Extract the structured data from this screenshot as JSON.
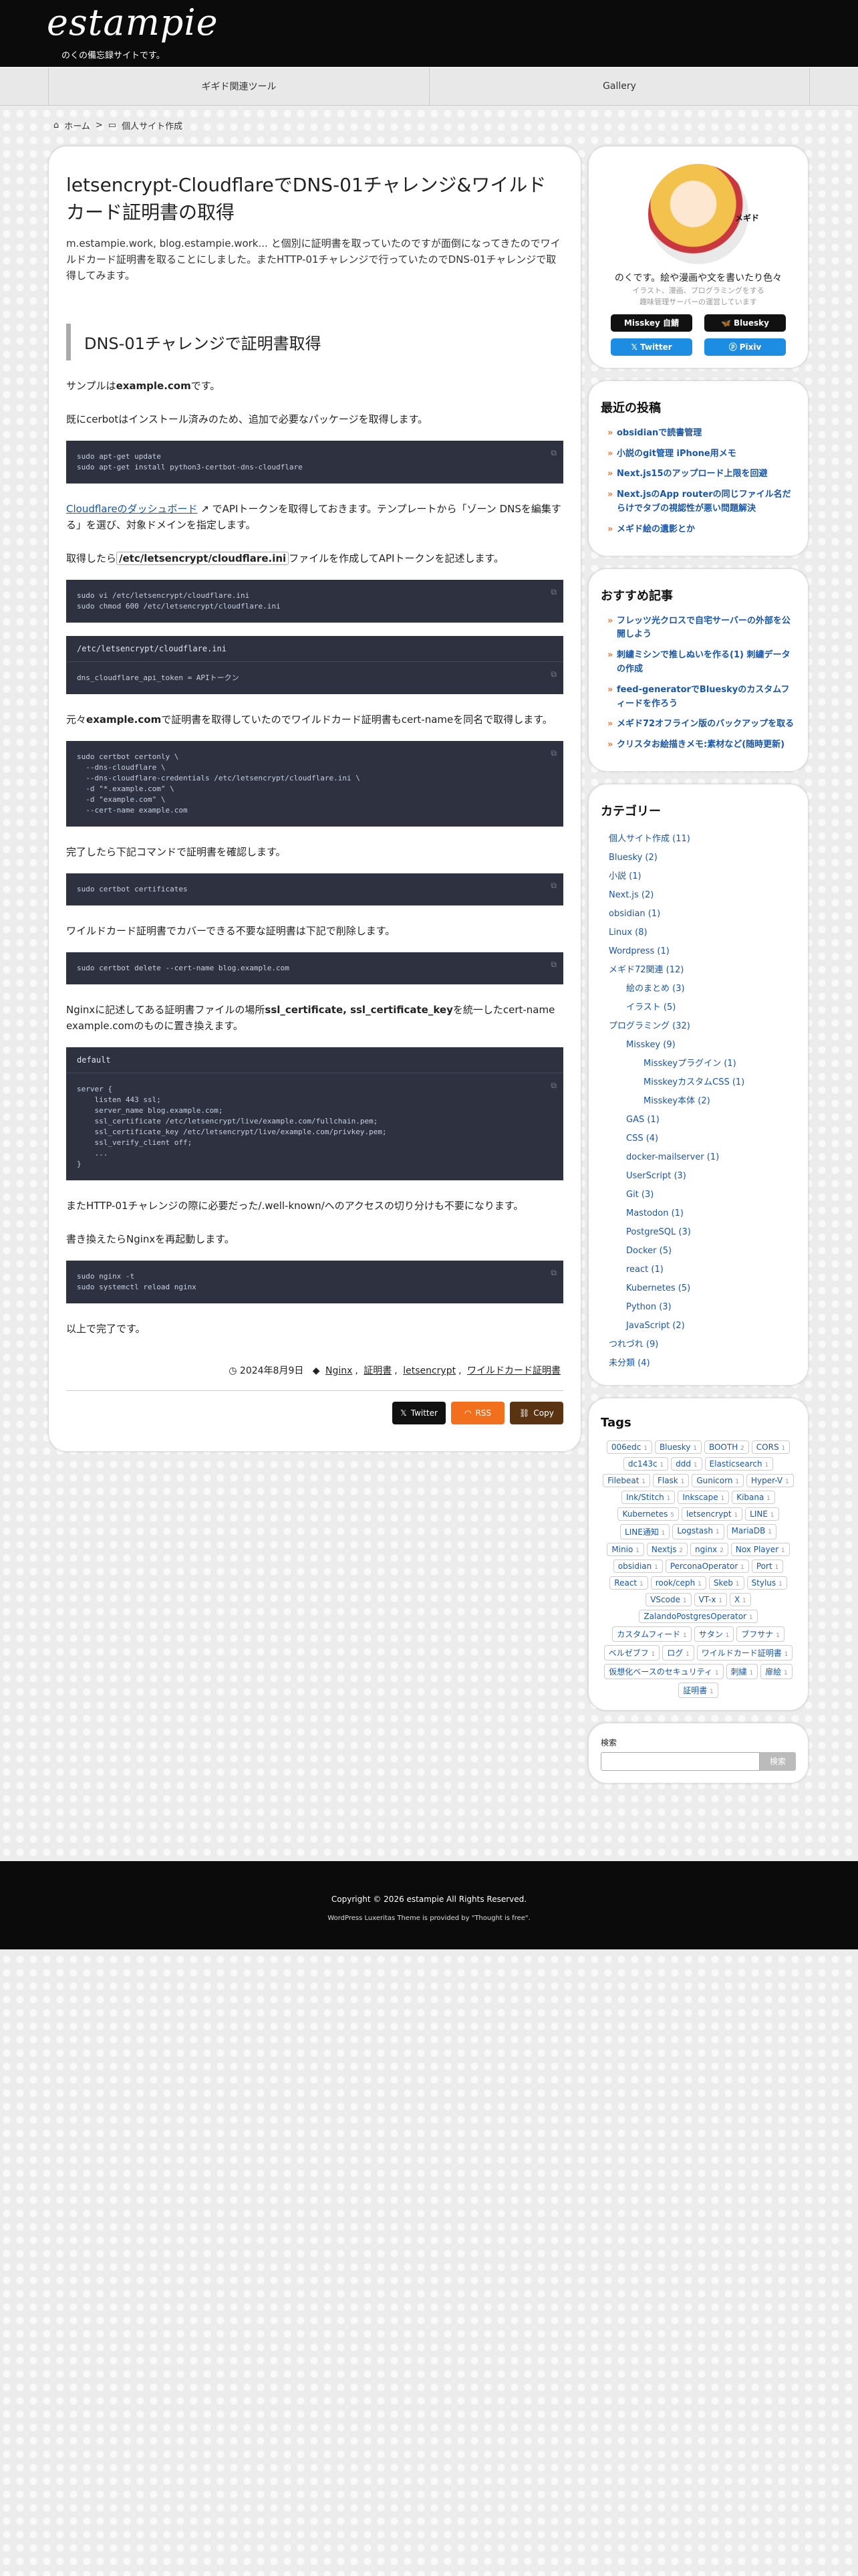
{
  "site": {
    "logo": "estampie",
    "tagline": "のくの備忘録サイトです。"
  },
  "nav": [
    "ギギド関連ツール",
    "Gallery"
  ],
  "breadcrumb": {
    "home": "ホーム",
    "category": "個人サイト作成"
  },
  "article": {
    "title": "letsencrypt-CloudflareでDNS-01チャレンジ&ワイルドカード証明書の取得",
    "lead": "m.estampie.work, blog.estampie.work... と個別に証明書を取っていたのですが面倒になってきたのでワイルドカード証明書を取ることにしました。またHTTP-01チャレンジで行っていたのでDNS-01チャレンジで取得してみます。",
    "h2": "DNS-01チャレンジで証明書取得",
    "p1a": "サンプルは",
    "p1b": "example.com",
    "p1c": "です。",
    "p2": "既にcerbotはインストール済みのため、追加で必要なパッケージを取得します。",
    "code1": "sudo apt-get update\nsudo apt-get install python3-certbot-dns-cloudflare",
    "p3link": "Cloudflareのダッシュボード",
    "p3": "でAPIトークンを取得しておきます。テンプレートから「ゾーン DNSを編集する」を選び、対象ドメインを指定します。",
    "p4a": "取得したら",
    "p4code": "/etc/letsencrypt/cloudflare.ini",
    "p4b": "ファイルを作成してAPIトークンを記述します。",
    "code2": "sudo vi /etc/letsencrypt/cloudflare.ini\nsudo chmod 600 /etc/letsencrypt/cloudflare.ini",
    "file3": "/etc/letsencrypt/cloudflare.ini",
    "code3": "dns_cloudflare_api_token = APIトークン",
    "p5a": "元々",
    "p5b": "example.com",
    "p5c": "で証明書を取得していたのでワイルドカード証明書もcert-nameを同名で取得します。",
    "code4": "sudo certbot certonly \\\n  --dns-cloudflare \\\n  --dns-cloudflare-credentials /etc/letsencrypt/cloudflare.ini \\\n  -d \"*.example.com\" \\\n  -d \"example.com\" \\\n  --cert-name example.com",
    "p6": "完了したら下記コマンドで証明書を確認します。",
    "code5": "sudo certbot certificates",
    "p7": "ワイルドカード証明書でカバーできる不要な証明書は下記で削除します。",
    "code6": "sudo certbot delete --cert-name blog.example.com",
    "p8a": "Nginxに記述してある証明書ファイルの場所",
    "p8b": "ssl_certificate, ssl_certificate_key",
    "p8c": "を統一したcert-name example.comのものに置き換えます。",
    "file9": "default",
    "code9": "server {\n    listen 443 ssl;\n    server_name blog.example.com;\n    ssl_certificate /etc/letsencrypt/live/example.com/fullchain.pem;\n    ssl_certificate_key /etc/letsencrypt/live/example.com/privkey.pem;\n    ssl_verify_client off;\n    ...\n}",
    "p9": "またHTTP-01チャレンジの際に必要だった/.well-known/へのアクセスの切り分けも不要になります。",
    "p10": "書き換えたらNginxを再起動します。",
    "code10": "sudo nginx -t\nsudo systemctl reload nginx",
    "p11": "以上で完了です。",
    "date": "2024年8月9日",
    "tags": [
      "Nginx",
      "証明書",
      "letsencrypt",
      "ワイルドカード証明書"
    ],
    "share": {
      "twitter": "Twitter",
      "rss": "RSS",
      "copy": "Copy"
    }
  },
  "profile": {
    "name": "のくです。絵や漫画や文を書いたり色々",
    "sub1": "イラスト、漫画、プログラミングをする",
    "sub2": "趣味管理サーバーの運営しています",
    "misskey": "Misskey 自鯖",
    "bluesky": "Bluesky",
    "twitter": "Twitter",
    "pixiv": "Pixiv",
    "avatar_label": "メギド"
  },
  "recent": {
    "title": "最近の投稿",
    "items": [
      "obsidianで読書管理",
      "小説のgit管理 iPhone用メモ",
      "Next.js15のアップロード上限を回避",
      "Next.jsのApp routerの同じファイル名だらけでタブの視認性が悪い問題解決",
      "メギド絵の遺影とか"
    ]
  },
  "recommend": {
    "title": "おすすめ記事",
    "items": [
      "フレッツ光クロスで自宅サーバーの外部を公開しよう",
      "刺繍ミシンで推しぬいを作る(1) 刺繍データの作成",
      "feed-generatorでBlueskyのカスタムフィードを作ろう",
      "メギド72オフライン版のバックアップを取る",
      "クリスタお絵描きメモ:素材など(随時更新)"
    ]
  },
  "categories": {
    "title": "カテゴリー",
    "items": [
      {
        "label": "個人サイト作成 (11)",
        "lv": 0
      },
      {
        "label": "Bluesky (2)",
        "lv": 0
      },
      {
        "label": "小説 (1)",
        "lv": 0
      },
      {
        "label": "Next.js (2)",
        "lv": 0
      },
      {
        "label": "obsidian (1)",
        "lv": 0
      },
      {
        "label": "Linux (8)",
        "lv": 0
      },
      {
        "label": "Wordpress (1)",
        "lv": 0
      },
      {
        "label": "メギド72関連 (12)",
        "lv": 0
      },
      {
        "label": "絵のまとめ (3)",
        "lv": 1
      },
      {
        "label": "イラスト (5)",
        "lv": 1
      },
      {
        "label": "プログラミング (32)",
        "lv": 0
      },
      {
        "label": "Misskey (9)",
        "lv": 1
      },
      {
        "label": "Misskeyプラグイン (1)",
        "lv": 2
      },
      {
        "label": "MisskeyカスタムCSS (1)",
        "lv": 2
      },
      {
        "label": "Misskey本体 (2)",
        "lv": 2
      },
      {
        "label": "GAS (1)",
        "lv": 1
      },
      {
        "label": "CSS (4)",
        "lv": 1
      },
      {
        "label": "docker-mailserver (1)",
        "lv": 1
      },
      {
        "label": "UserScript (3)",
        "lv": 1
      },
      {
        "label": "Git (3)",
        "lv": 1
      },
      {
        "label": "Mastodon (1)",
        "lv": 1
      },
      {
        "label": "PostgreSQL (3)",
        "lv": 1
      },
      {
        "label": "Docker (5)",
        "lv": 1
      },
      {
        "label": "react (1)",
        "lv": 1
      },
      {
        "label": "Kubernetes (5)",
        "lv": 1
      },
      {
        "label": "Python (3)",
        "lv": 1
      },
      {
        "label": "JavaScript (2)",
        "lv": 1
      },
      {
        "label": "つれづれ (9)",
        "lv": 0
      },
      {
        "label": "未分類 (4)",
        "lv": 0
      }
    ]
  },
  "tagcloud": {
    "title": "Tags",
    "items": [
      [
        "006edc",
        "1"
      ],
      [
        "Bluesky",
        "1"
      ],
      [
        "BOOTH",
        "2"
      ],
      [
        "CORS",
        "1"
      ],
      [
        "dc143c",
        "1"
      ],
      [
        "ddd",
        "1"
      ],
      [
        "Elasticsearch",
        "1"
      ],
      [
        "Filebeat",
        "1"
      ],
      [
        "Flask",
        "1"
      ],
      [
        "Gunicorn",
        "1"
      ],
      [
        "Hyper-V",
        "1"
      ],
      [
        "Ink/Stitch",
        "1"
      ],
      [
        "Inkscape",
        "1"
      ],
      [
        "Kibana",
        "1"
      ],
      [
        "Kubernetes",
        "5"
      ],
      [
        "letsencrypt",
        "1"
      ],
      [
        "LINE",
        "1"
      ],
      [
        "LINE通知",
        "1"
      ],
      [
        "Logstash",
        "1"
      ],
      [
        "MariaDB",
        "1"
      ],
      [
        "Minio",
        "1"
      ],
      [
        "Nextjs",
        "2"
      ],
      [
        "nginx",
        "2"
      ],
      [
        "Nox Player",
        "1"
      ],
      [
        "obsidian",
        "1"
      ],
      [
        "PerconaOperator",
        "1"
      ],
      [
        "Port",
        "1"
      ],
      [
        "React",
        "1"
      ],
      [
        "rook/ceph",
        "1"
      ],
      [
        "Skeb",
        "1"
      ],
      [
        "Stylus",
        "1"
      ],
      [
        "VScode",
        "1"
      ],
      [
        "VT-x",
        "1"
      ],
      [
        "X",
        "1"
      ],
      [
        "ZalandoPostgresOperator",
        "1"
      ],
      [
        "カスタムフィード",
        "1"
      ],
      [
        "サタン",
        "1"
      ],
      [
        "ブフサナ",
        "1"
      ],
      [
        "ベルゼブフ",
        "1"
      ],
      [
        "ログ",
        "1"
      ],
      [
        "ワイルドカード証明書",
        "1"
      ],
      [
        "仮想化ベースのセキュリティ",
        "1"
      ],
      [
        "刺繍",
        "1"
      ],
      [
        "扉絵",
        "1"
      ],
      [
        "証明書",
        "1"
      ]
    ]
  },
  "search": {
    "title": "検索",
    "button": "検索",
    "placeholder": ""
  },
  "footer": {
    "copy": "Copyright © 2026 estampie All Rights Reserved.",
    "theme": "WordPress Luxeritas Theme is provided by \"Thought is free\"."
  }
}
